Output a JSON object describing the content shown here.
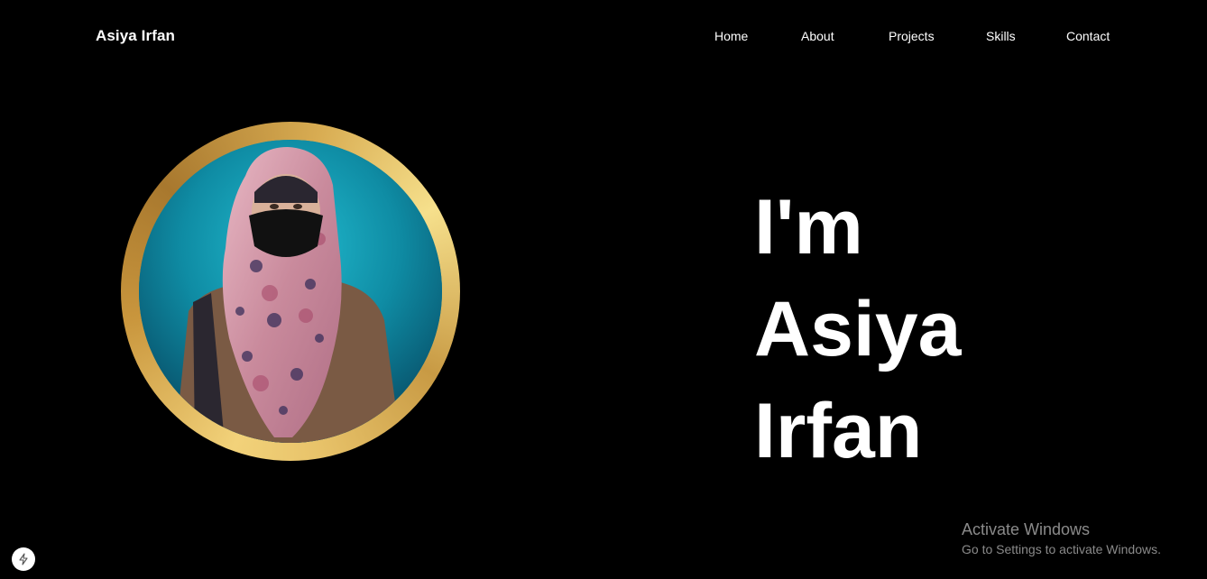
{
  "header": {
    "brand": "Asiya Irfan",
    "nav": {
      "home": "Home",
      "about": "About",
      "projects": "Projects",
      "skills": "Skills",
      "contact": "Contact"
    }
  },
  "hero": {
    "line1": "I'm",
    "line2": "Asiya",
    "line3": "Irfan",
    "avatar_icon": "profile-photo",
    "ring_color": "#d4a84b"
  },
  "watermark": {
    "title": "Activate Windows",
    "subtitle": "Go to Settings to activate Windows."
  },
  "floating_button": {
    "icon": "lightning-bolt-icon"
  },
  "colors": {
    "background": "#000000",
    "text": "#ffffff",
    "watermark": "#8a8a8a"
  }
}
